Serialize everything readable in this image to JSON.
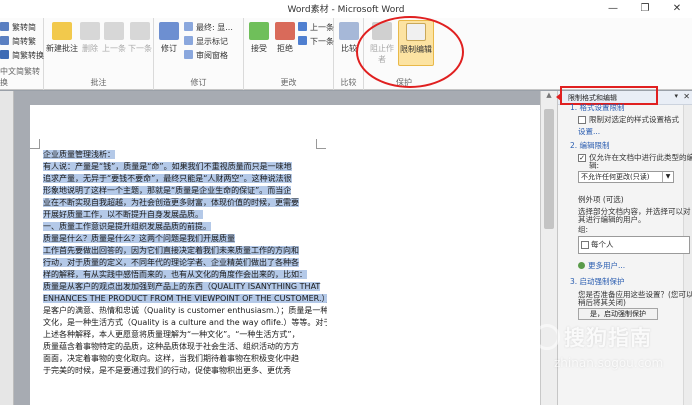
{
  "window": {
    "title": "Word素材 - Microsoft Word",
    "controls": [
      "—",
      "❐",
      "✕"
    ]
  },
  "ribbon": {
    "chinese_group": {
      "items": [
        "繁转简",
        "简转繁",
        "简繁转换"
      ],
      "label": "中文简繁转换"
    },
    "comments_group": {
      "new_comment": "新建批注",
      "delete": "删除",
      "prev": "上一条",
      "next": "下一条",
      "label": "批注"
    },
    "tracking_group": {
      "track": "修订",
      "final_show": "最终: 显...",
      "show_markup": "显示标记",
      "review_pane": "审阅窗格",
      "label": "修订"
    },
    "changes_group": {
      "accept": "接受",
      "reject": "拒绝",
      "prev": "上一条",
      "next": "下一条",
      "label": "更改"
    },
    "compare_group": {
      "compare": "比较",
      "label": "比较"
    },
    "protect_group": {
      "block_authors": "阻止作者",
      "restrict_editing": "限制编辑",
      "label": "保护"
    }
  },
  "document": {
    "lines": [
      {
        "text": "企业质量管理浅析：",
        "selected": true
      },
      {
        "text": "有人说：产量是“钱”，质量是“命”。如果我们不重视质量而只是一味地",
        "selected": true
      },
      {
        "text": "追求产量，无异于“要钱不要命”，最终只能是“人财两空”。这种说法很",
        "selected": true
      },
      {
        "text": "形象地说明了这样一个主题，那就是“质量是企业生命的保证”。而当企",
        "selected": true
      },
      {
        "text": "业在不断实现自我超越，为社会创造更多财富，体现价值的时候，更需要",
        "selected": true
      },
      {
        "text": "开展好质量工作，以不断提升自身发展品质。",
        "selected": true
      },
      {
        "text": "一、质量工作意识是提升组织发展品质的前提。",
        "selected": true
      },
      {
        "text": "质量是什么？质量是什么？这两个问题是我们开展质量",
        "selected": true
      },
      {
        "text": "工作首先要做出回答的，因为它们直接决定着我们未来质量工作的方向和",
        "selected": true
      },
      {
        "text": "行动，对于质量的定义，不同年代的理论学者、企业精英们做出了各种各",
        "selected": true
      },
      {
        "text": "样的解释，有从实践中感悟而来的，也有从文化的角度作会出来的，比如：",
        "selected": true
      },
      {
        "text": "质量是从客户的观点出发加强到产品上的东西（QUALITY ISANYTHING THAT",
        "selected": true
      },
      {
        "text": "ENHANCES THE PRODUCT FROM THE VIEWPOINT OF THE CUSTOMER.）；质量",
        "selected": true
      },
      {
        "text": "是客户的满意、热情和忠诚（Quality is customer enthusiasm.）；质量是一种",
        "selected": false
      },
      {
        "text": "文化，是一种生活方式（Quality is a culture and the way oflife.）等等。对于",
        "selected": false
      },
      {
        "text": "上述各种解释，本人更愿意将质量理解为“一种文化”。“一种生活方式”，",
        "selected": false
      },
      {
        "text": "质量蕴含着事物特定的品质，这种品质体现于社会生活、组织活动的方方",
        "selected": false
      },
      {
        "text": "面面，决定着事物的变化取向。这样，当我们期待着事物在积极变化中趋",
        "selected": false
      },
      {
        "text": "于完美的时候，是不是要通过我们的行动，促使事物积出更多、更优秀",
        "selected": false
      }
    ]
  },
  "pane": {
    "title": "限制格式和编辑",
    "menu": "▾",
    "close": "✕",
    "sec1_title": "1. 格式设置限制",
    "sec1_check": "限制对选定的样式设置格式",
    "sec1_link": "设置...",
    "sec2_title": "2. 编辑限制",
    "sec2_check_1": "仅允许在文档中进行此类型的编",
    "sec2_check_2": "辑:",
    "sec2_select": "不允许任何更改(只读)",
    "exceptions_title": "例外项 (可选)",
    "exceptions_desc_1": "选择部分文档内容，并选择可以对",
    "exceptions_desc_2": "其进行编辑的用户。",
    "group_label": "组:",
    "everyone": "每个人",
    "more_users": "更多用户...",
    "sec3_title": "3. 启动强制保护",
    "sec3_desc_1": "您是否准备应用这些设置？(您可以",
    "sec3_desc_2": "稍后将其关闭)",
    "start_button": "是，启动强制保护"
  },
  "watermark": {
    "text": "搜狗指南",
    "url": "zhinan.sogou.com"
  },
  "colors": {
    "selection": "#b4c9e8",
    "annotation_red": "#e02020",
    "highlight": "#fce3a2"
  }
}
